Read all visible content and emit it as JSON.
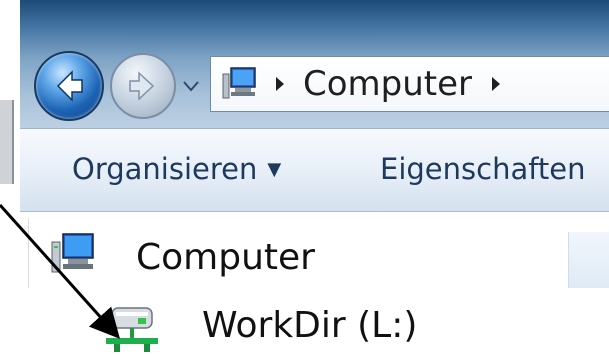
{
  "addressbar": {
    "crumbs": [
      "Computer"
    ]
  },
  "toolbar": {
    "organize_label": "Organisieren",
    "properties_label": "Eigenschaften"
  },
  "navpane": {
    "items": [
      {
        "label": "Computer",
        "icon": "computer-icon"
      },
      {
        "label": "WorkDir (L:)",
        "icon": "network-drive-icon"
      }
    ]
  }
}
